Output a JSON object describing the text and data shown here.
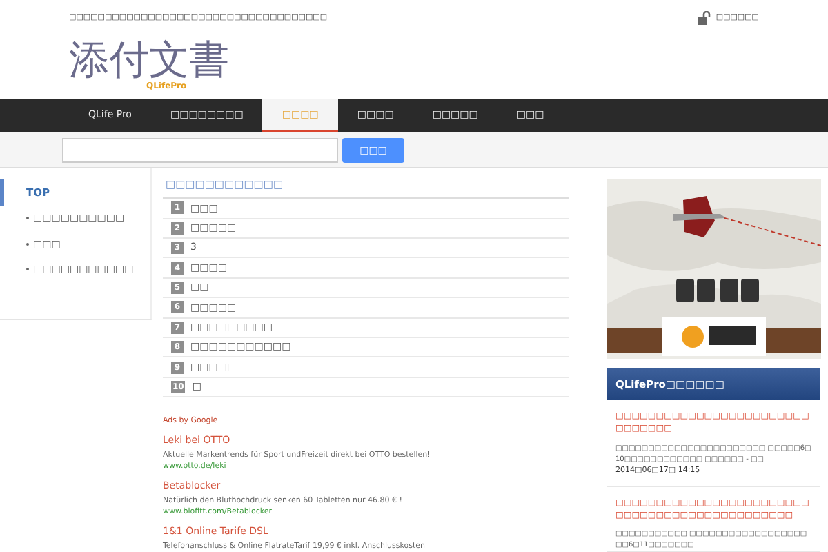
{
  "header": {
    "tagline": "□□□□□□□□□□□□□□□□□□□□□□□□□□□□□□□□□□□□",
    "login": "□□□□□□",
    "logo": "添付文書",
    "logo_sub": "QLifePro"
  },
  "nav": [
    {
      "label": "QLife Pro",
      "selected": false
    },
    {
      "label": "□□□□□□□□",
      "selected": false
    },
    {
      "label": "□□□□",
      "selected": true
    },
    {
      "label": "□□□□",
      "selected": false
    },
    {
      "label": "□□□□□",
      "selected": false
    },
    {
      "label": "□□□",
      "selected": false
    }
  ],
  "search": {
    "button": "□□□"
  },
  "sidebar": {
    "items": [
      {
        "label": "TOP",
        "selected": true
      },
      {
        "label": "□□□□□□□□□□",
        "selected": false
      },
      {
        "label": "□□□",
        "selected": false
      },
      {
        "label": "□□□□□□□□□□□",
        "selected": false
      }
    ]
  },
  "ranking": {
    "title": "□□□□□□□□□□□□",
    "items": [
      {
        "rank": "1",
        "text": "□□□"
      },
      {
        "rank": "2",
        "text": "□□□□□"
      },
      {
        "rank": "3",
        "text": "3"
      },
      {
        "rank": "4",
        "text": "□□□□"
      },
      {
        "rank": "5",
        "text": "□□"
      },
      {
        "rank": "6",
        "text": "□□□□□"
      },
      {
        "rank": "7",
        "text": "□□□□□□□□□"
      },
      {
        "rank": "8",
        "text": "□□□□□□□□□□□"
      },
      {
        "rank": "9",
        "text": "□□□□□"
      },
      {
        "rank": "10",
        "text": "□"
      }
    ]
  },
  "ads": {
    "label": "Ads by Google",
    "items": [
      {
        "title": "Leki bei OTTO",
        "text": "Aktuelle Markentrends für Sport undFreizeit direkt bei OTTO bestellen!",
        "url": "www.otto.de/leki"
      },
      {
        "title": "Betablocker",
        "text": "Natürlich den Bluthochdruck senken.60 Tabletten nur 46.80 € !",
        "url": "www.biofitt.com/Betablocker"
      },
      {
        "title": "1&1 Online Tarife DSL",
        "text": "Telefonanschluss & Online FlatrateTarif 19,99 € inkl. Anschlusskosten"
      }
    ]
  },
  "news": {
    "title": "QLifePro□□□□□□",
    "items": [
      {
        "title": "□□□□□□□□□□□□□□□□□□□□□□□□□□□□□□□",
        "text": "□□□□□□□□□□□□□□□□□□□□□□□ □□□□□6□10□□□□□□□□□□□□ □□□□□□ - □□",
        "date": "2014□06□17□ 14:15"
      },
      {
        "title": "□□□□□□□□□□□□□□□□□□□□□□□□□□□□□□□□□□□□□□□□□□□□□□",
        "text": "□□□□□□□□□□□ □□□□□□□□□□□□□□□□□□□□6□11□□□□□□□"
      }
    ]
  }
}
